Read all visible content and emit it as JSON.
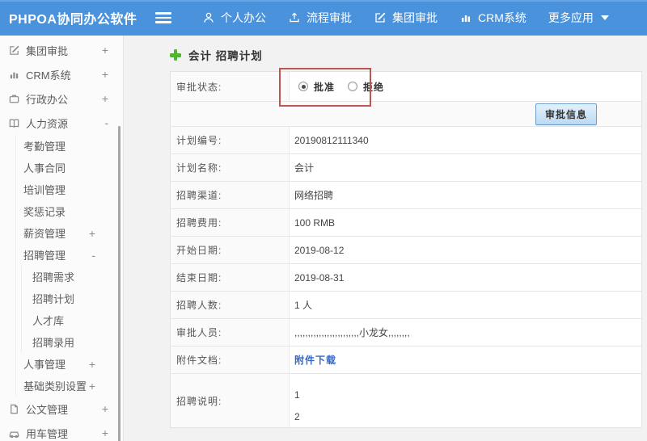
{
  "colors": {
    "topbar_blue": "#4a93dc",
    "highlight_red": "#bf5450",
    "link_blue": "#3568c4",
    "plus_green": "#53b332",
    "button_border_blue": "#6f9fcd"
  },
  "topbar": {
    "logo": "PHPOA协同办公软件",
    "items": [
      {
        "label": "个人办公",
        "icon": "person-icon"
      },
      {
        "label": "流程审批",
        "icon": "process-upload-icon"
      },
      {
        "label": "集团审批",
        "icon": "edit-square-icon"
      },
      {
        "label": "CRM系统",
        "icon": "bar-chart-icon"
      },
      {
        "label": "更多应用",
        "icon": "caret-down-icon"
      }
    ]
  },
  "sidebar": {
    "items": [
      {
        "label": "集团审批",
        "icon": "edit-square-icon",
        "expander": "+"
      },
      {
        "label": "CRM系统",
        "icon": "bar-chart-icon",
        "expander": "+"
      },
      {
        "label": "行政办公",
        "icon": "briefcase-icon",
        "expander": "+"
      },
      {
        "label": "人力资源",
        "icon": "book-icon",
        "expander": "-"
      },
      {
        "label": "考勤管理"
      },
      {
        "label": "人事合同"
      },
      {
        "label": "培训管理"
      },
      {
        "label": "奖惩记录"
      },
      {
        "label": "薪资管理",
        "expander": "+"
      },
      {
        "label": "招聘管理",
        "expander": "-"
      },
      {
        "label": "招聘需求"
      },
      {
        "label": "招聘计划"
      },
      {
        "label": "人才库"
      },
      {
        "label": "招聘录用"
      },
      {
        "label": "人事管理",
        "expander": "+"
      },
      {
        "label": "基础类别设置",
        "expander": "+"
      },
      {
        "label": "公文管理",
        "icon": "document-icon",
        "expander": "+"
      },
      {
        "label": "用车管理",
        "icon": "car-icon",
        "expander": "+"
      }
    ]
  },
  "main": {
    "title": "会计 招聘计划",
    "approval": {
      "label": "审批状态:",
      "options": [
        {
          "label": "批准",
          "selected": true
        },
        {
          "label": "拒绝",
          "selected": false
        }
      ]
    },
    "approve_button": "审批信息",
    "rows": [
      {
        "label": "计划编号:",
        "value": "20190812111340"
      },
      {
        "label": "计划名称:",
        "value": "会计"
      },
      {
        "label": "招聘渠道:",
        "value": "网络招聘"
      },
      {
        "label": "招聘费用:",
        "value": "100 RMB"
      },
      {
        "label": "开始日期:",
        "value": "2019-08-12"
      },
      {
        "label": "结束日期:",
        "value": "2019-08-31"
      },
      {
        "label": "招聘人数:",
        "value": "1 人"
      },
      {
        "label": "审批人员:",
        "value": ",,,,,,,,,,,,,,,,,,,,,,,,小龙女,,,,,,,,"
      },
      {
        "label": "附件文档:",
        "value": "附件下载"
      },
      {
        "label": "招聘说明:",
        "lines": [
          "1",
          "2"
        ]
      }
    ]
  }
}
